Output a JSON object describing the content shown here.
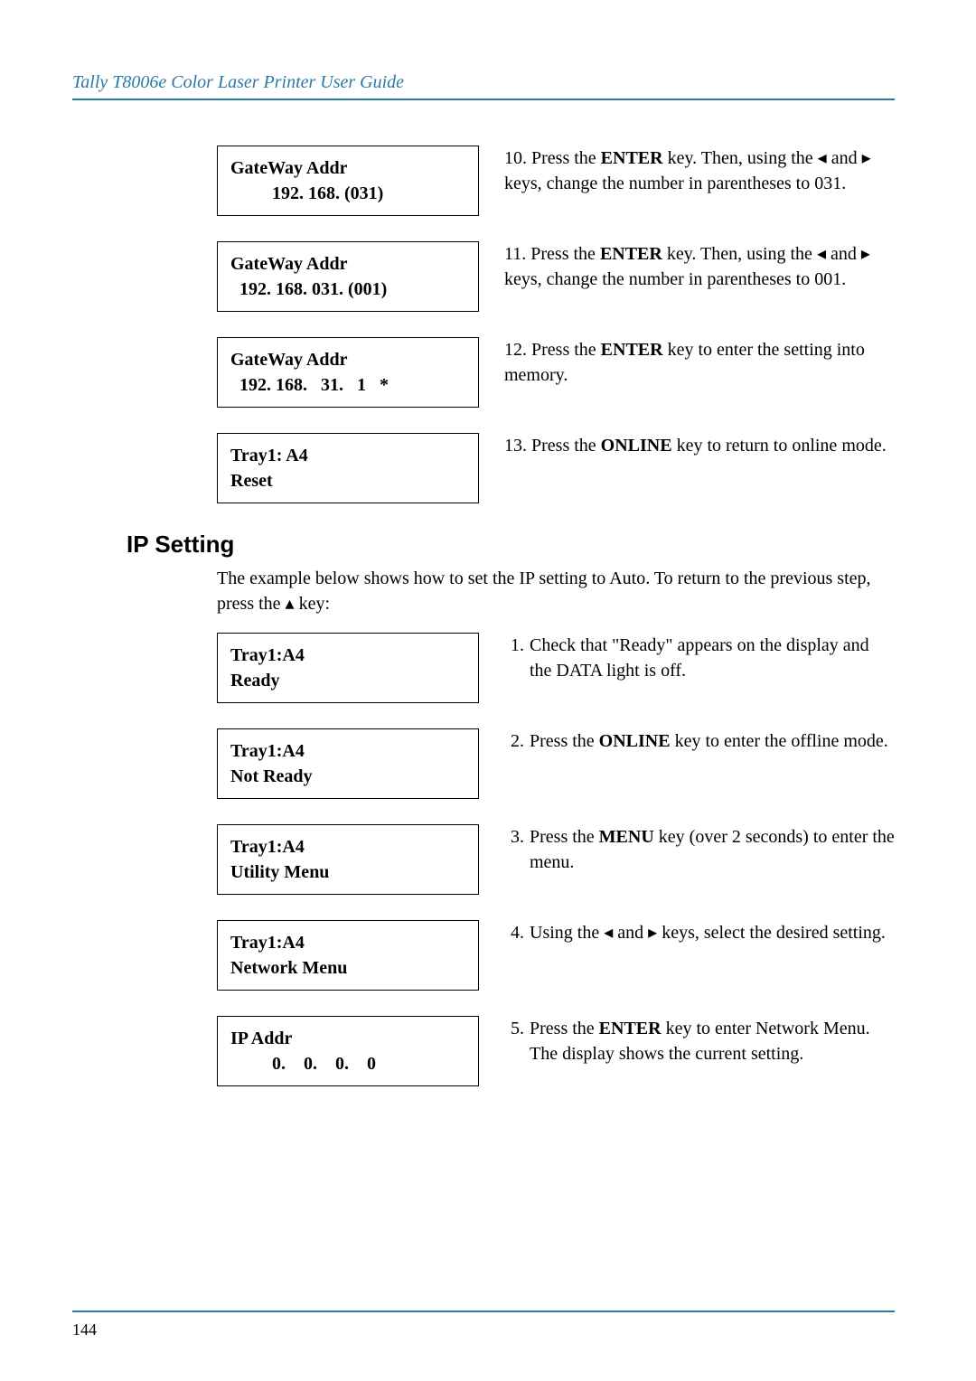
{
  "header": {
    "title": "Tally T8006e Color Laser Printer User Guide"
  },
  "steps_top": [
    {
      "display_line1": "GateWay Addr",
      "display_line2": "192. 168. (031)",
      "num": "10.",
      "text_parts": [
        "Press the ",
        "ENTER",
        " key. Then, using the ",
        "◂",
        " and ",
        "▸",
        " keys, change the number in parentheses to 031."
      ]
    },
    {
      "display_line1": "GateWay Addr",
      "display_line2": "192. 168. 031. (001)",
      "num": "11.",
      "text_parts": [
        "Press the ",
        "ENTER",
        " key. Then, using the ",
        "◂",
        " and ",
        "▸",
        " keys, change the number in parentheses to 001."
      ]
    },
    {
      "display_line1": "GateWay Addr",
      "display_line2": "192. 168.   31.   1   *",
      "num": "12.",
      "text_parts": [
        "Press the ",
        "ENTER",
        " key to enter the setting into memory."
      ]
    },
    {
      "display_line1": "Tray1:  A4",
      "display_line2": "Reset",
      "num": "13.",
      "text_parts": [
        "Press the ",
        "ONLINE",
        " key to return to online mode."
      ]
    }
  ],
  "section": {
    "title": "IP Setting",
    "intro_parts": [
      "The example below shows how to set the IP setting to Auto.  To return to the previous step, press the ",
      "▴",
      " key:"
    ]
  },
  "steps_bottom": [
    {
      "display_line1": "Tray1:A4",
      "display_line2": "Ready",
      "num": "1.",
      "text_parts": [
        "Check that \"Ready\" appears on the display and the DATA light is off."
      ]
    },
    {
      "display_line1": "Tray1:A4",
      "display_line2": "Not Ready",
      "num": "2.",
      "text_parts": [
        "Press the ",
        "ONLINE",
        " key to enter the offline mode."
      ]
    },
    {
      "display_line1": "Tray1:A4",
      "display_line2": "Utility Menu",
      "num": "3.",
      "text_parts": [
        "Press the ",
        "MENU",
        " key (over 2 seconds) to enter the menu."
      ]
    },
    {
      "display_line1": "Tray1:A4",
      "display_line2": "Network Menu",
      "num": "4.",
      "text_parts": [
        "Using the ",
        "◂",
        " and ",
        "▸",
        " keys, select the desired setting."
      ]
    },
    {
      "display_line1": "IP Addr",
      "display_line2": "0.    0.    0.    0",
      "num": "5.",
      "text_parts": [
        "Press the ",
        "ENTER",
        " key to enter Network Menu. The display shows the current setting."
      ]
    }
  ],
  "page_number": "144"
}
